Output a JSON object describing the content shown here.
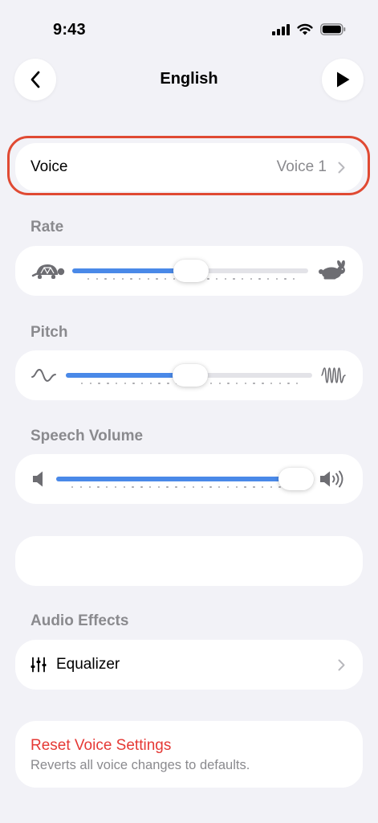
{
  "status_bar": {
    "time": "9:43"
  },
  "nav": {
    "title": "English"
  },
  "voice": {
    "label": "Voice",
    "value": "Voice 1"
  },
  "rate": {
    "label": "Rate",
    "level": 0.5
  },
  "pitch": {
    "label": "Pitch",
    "level": 0.5
  },
  "speech_volume": {
    "label": "Speech Volume",
    "level": 1.0
  },
  "audio_effects": {
    "label": "Audio Effects",
    "equalizer_label": "Equalizer"
  },
  "reset": {
    "title": "Reset Voice Settings",
    "subtitle": "Reverts all voice changes to defaults."
  },
  "colors": {
    "accent": "#4a89e8",
    "highlight": "#e04a33",
    "destructive": "#e53935"
  },
  "icons": [
    "back-chevron-icon",
    "play-icon",
    "chevron-right-icon",
    "turtle-icon",
    "rabbit-icon",
    "wave-low-icon",
    "wave-high-icon",
    "speaker-low-icon",
    "speaker-high-icon",
    "sliders-icon"
  ]
}
